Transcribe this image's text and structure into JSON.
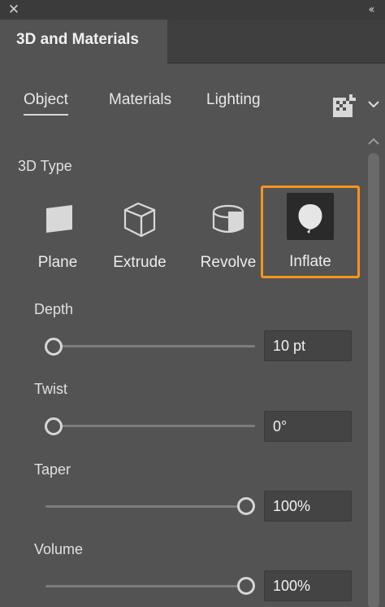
{
  "panel": {
    "title": "3D and Materials",
    "close_icon": "close-icon",
    "collapse_icon": "double-chevron-left-icon"
  },
  "subtabs": [
    {
      "label": "Object",
      "active": true
    },
    {
      "label": "Materials",
      "active": false
    },
    {
      "label": "Lighting",
      "active": false
    }
  ],
  "toolbar_icons": [
    "render-preset-grid-icon",
    "chevron-down-icon"
  ],
  "section": {
    "label": "3D Type"
  },
  "types": [
    {
      "label": "Plane",
      "icon": "plane-icon",
      "selected": false
    },
    {
      "label": "Extrude",
      "icon": "extrude-cube-icon",
      "selected": false
    },
    {
      "label": "Revolve",
      "icon": "revolve-cylinder-icon",
      "selected": false
    },
    {
      "label": "Inflate",
      "icon": "balloon-icon",
      "selected": true
    }
  ],
  "properties": [
    {
      "label": "Depth",
      "value": "10 pt",
      "slider_fraction": 0.0
    },
    {
      "label": "Twist",
      "value": "0°",
      "slider_fraction": 0.0
    },
    {
      "label": "Taper",
      "value": "100%",
      "slider_fraction": 1.0
    },
    {
      "label": "Volume",
      "value": "100%",
      "slider_fraction": 1.0
    }
  ],
  "colors": {
    "accent_selected": "#f7951d",
    "panel_bg": "#535353"
  }
}
